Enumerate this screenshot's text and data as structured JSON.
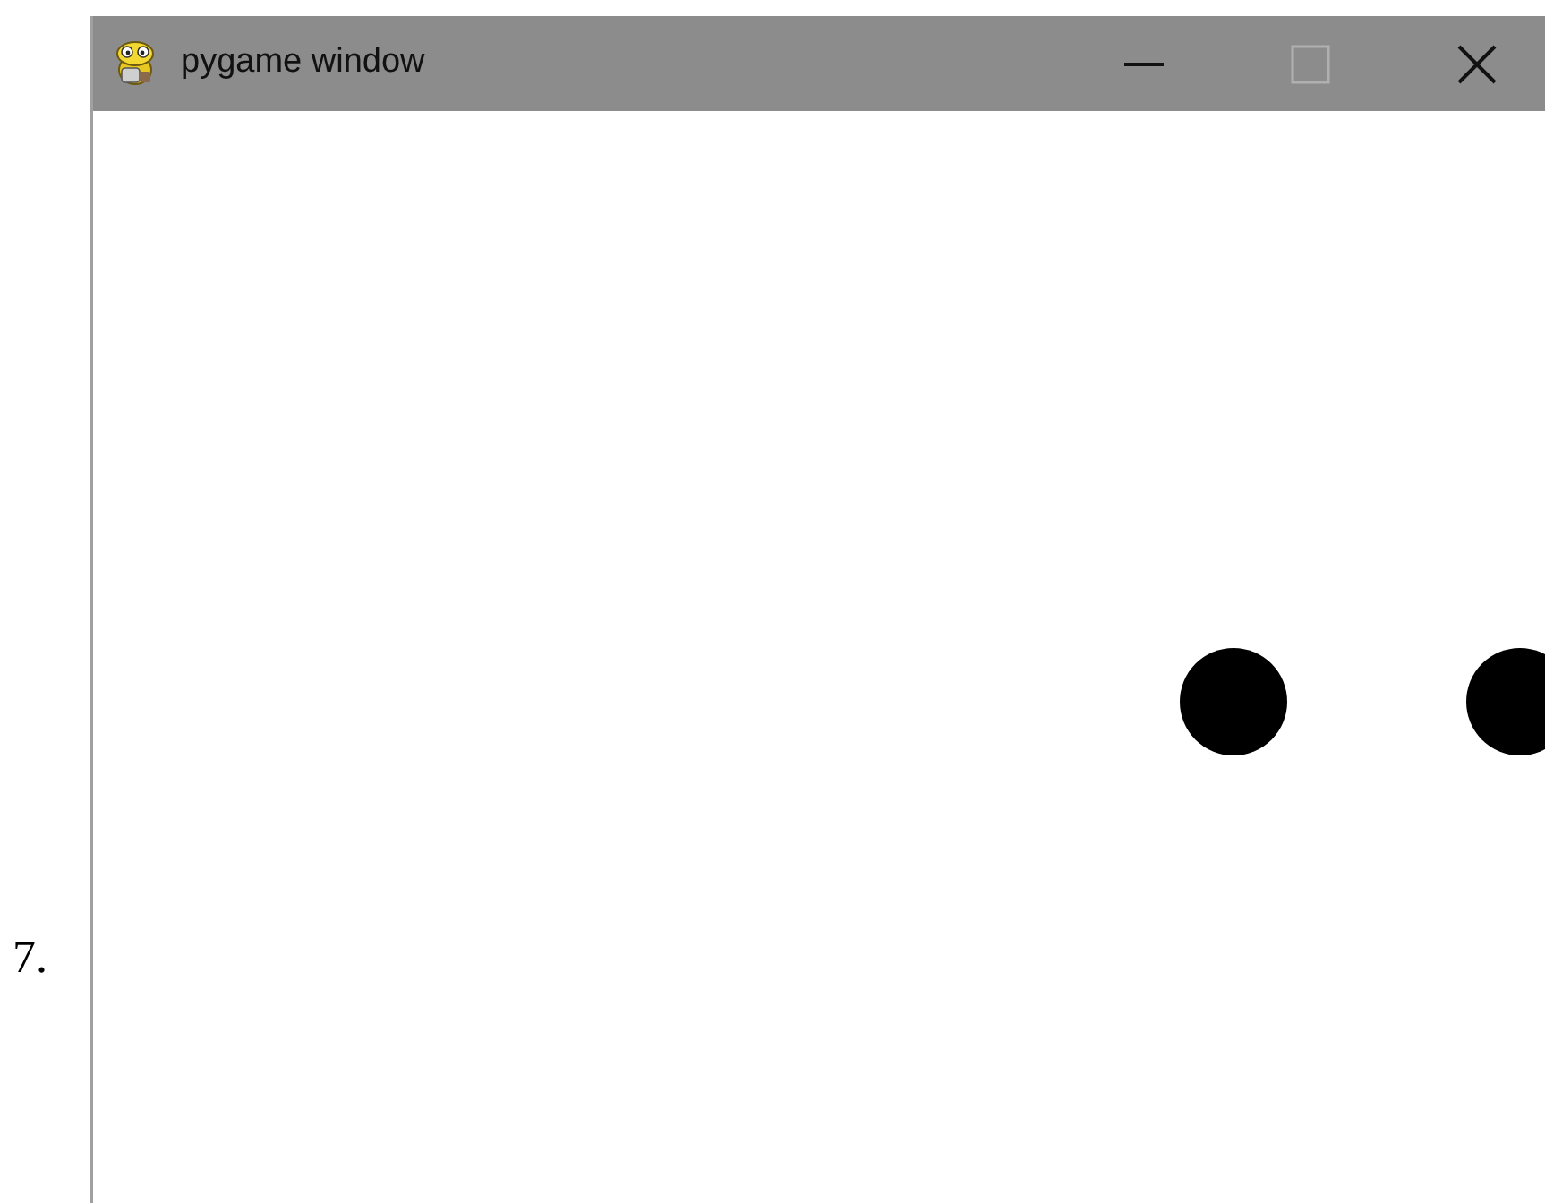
{
  "item_number": "7.",
  "window": {
    "title": "pygame window",
    "controls": [
      {
        "kind": "minimize",
        "disabled": false
      },
      {
        "kind": "maximize",
        "disabled": true
      },
      {
        "kind": "close",
        "disabled": false
      }
    ]
  }
}
